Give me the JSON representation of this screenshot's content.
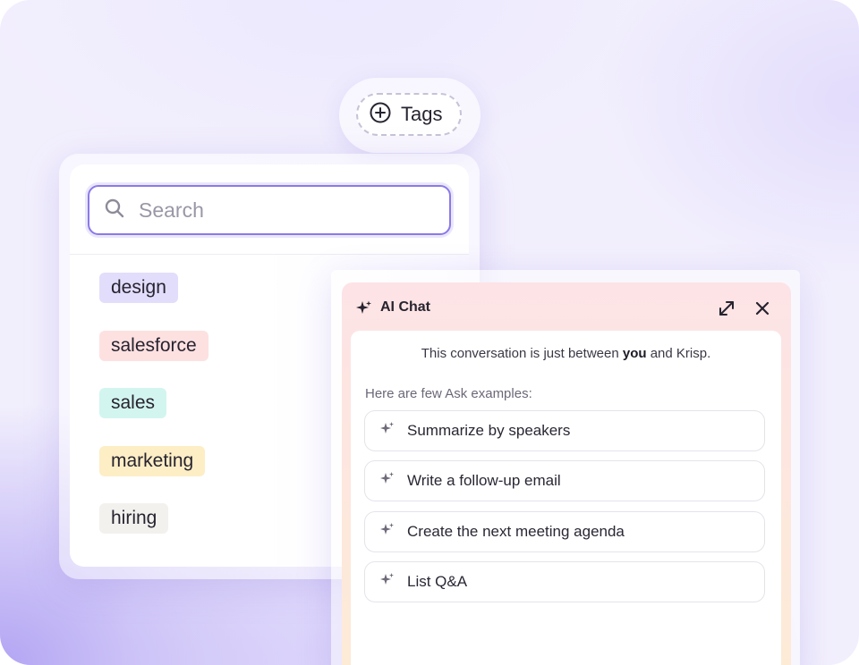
{
  "tags_button": {
    "label": "Tags",
    "icon": "plus-circle-icon"
  },
  "tag_panel": {
    "search": {
      "placeholder": "Search",
      "value": "",
      "icon": "search-icon"
    },
    "tags": [
      {
        "label": "design",
        "color": "#e2ddfb"
      },
      {
        "label": "salesforce",
        "color": "#fde1e1"
      },
      {
        "label": "sales",
        "color": "#d3f5ef"
      },
      {
        "label": "marketing",
        "color": "#fdeec6"
      },
      {
        "label": "hiring",
        "color": "#f3f1ee"
      }
    ]
  },
  "ai_chat": {
    "title": "AI Chat",
    "title_icon": "sparkle-icon",
    "expand_icon": "expand-icon",
    "close_icon": "close-icon",
    "privacy_prefix": "This conversation is just between",
    "privacy_bold": "you",
    "privacy_suffix": "and Krisp.",
    "examples_label": "Here are few Ask examples:",
    "suggestions": [
      {
        "label": "Summarize by speakers"
      },
      {
        "label": "Write a follow-up email"
      },
      {
        "label": "Create the next meeting agenda"
      },
      {
        "label": "List Q&A"
      }
    ]
  },
  "colors": {
    "accent": "#8b79e8",
    "background": "#f2effd"
  }
}
